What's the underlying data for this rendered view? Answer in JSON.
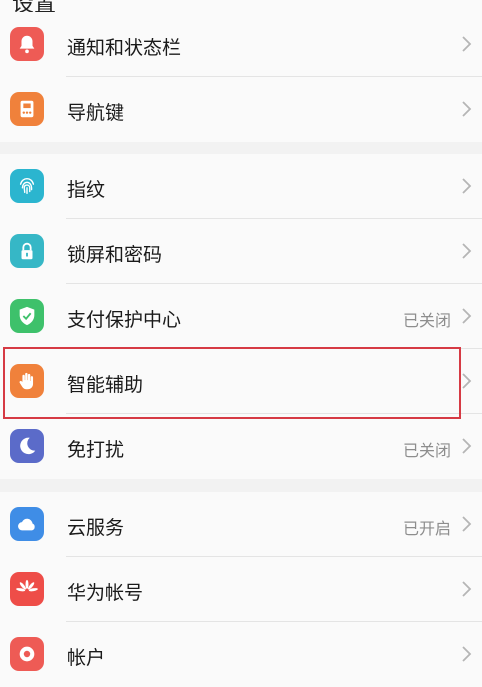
{
  "header": {
    "title": "设置"
  },
  "groups": [
    {
      "items": [
        {
          "label": "通知和状态栏",
          "value": "",
          "icon": "bell-icon",
          "color": "#ee5b55"
        },
        {
          "label": "导航键",
          "value": "",
          "icon": "navigation-key-icon",
          "color": "#f0813b"
        }
      ]
    },
    {
      "items": [
        {
          "label": "指纹",
          "value": "",
          "icon": "fingerprint-icon",
          "color": "#2bb5cf"
        },
        {
          "label": "锁屏和密码",
          "value": "",
          "icon": "lock-icon",
          "color": "#36b7c6"
        },
        {
          "label": "支付保护中心",
          "value": "已关闭",
          "icon": "shield-check-icon",
          "color": "#3ec16b"
        },
        {
          "label": "智能辅助",
          "value": "",
          "icon": "hand-icon",
          "color": "#f0813b"
        },
        {
          "label": "免打扰",
          "value": "已关闭",
          "icon": "moon-icon",
          "color": "#5b6bc9"
        }
      ]
    },
    {
      "items": [
        {
          "label": "云服务",
          "value": "已开启",
          "icon": "cloud-icon",
          "color": "#3f8de6"
        },
        {
          "label": "华为帐号",
          "value": "",
          "icon": "huawei-icon",
          "color": "#ee4d48"
        },
        {
          "label": "帐户",
          "value": "",
          "icon": "account-icon",
          "color": "#ee5b55"
        }
      ]
    }
  ]
}
